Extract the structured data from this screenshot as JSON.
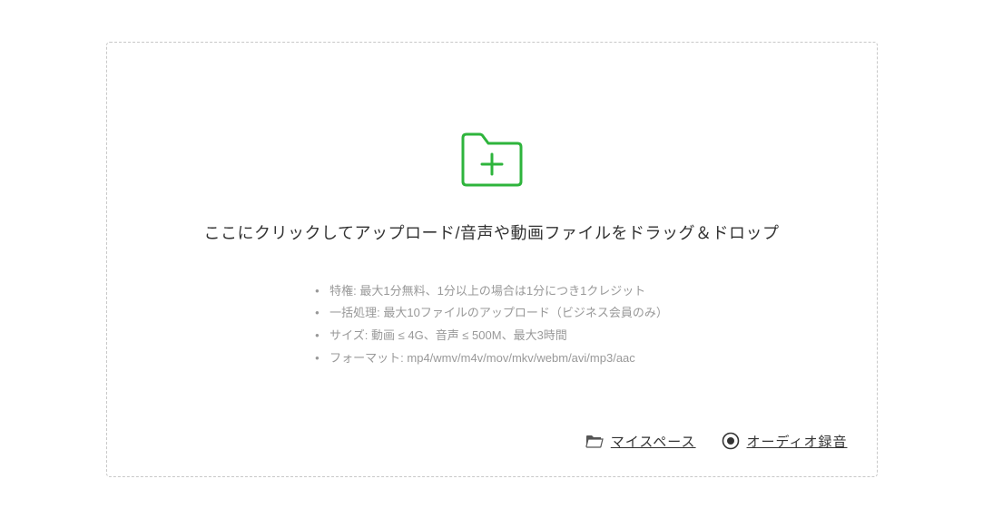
{
  "upload": {
    "heading": "ここにクリックしてアップロード/音声や動画ファイルをドラッグ＆ドロップ",
    "info": [
      "特権: 最大1分無料、1分以上の場合は1分につき1クレジット",
      "一括処理: 最大10ファイルのアップロード（ビジネス会員のみ）",
      "サイズ: 動画 ≤ 4G、音声 ≤ 500M、最大3時間",
      "フォーマット: mp4/wmv/m4v/mov/mkv/webm/avi/mp3/aac"
    ]
  },
  "actions": {
    "myspace": "マイスペース",
    "audio_record": "オーディオ録音"
  },
  "colors": {
    "accent": "#2eb43c",
    "border": "#c8c8c8",
    "text_muted": "#999"
  }
}
